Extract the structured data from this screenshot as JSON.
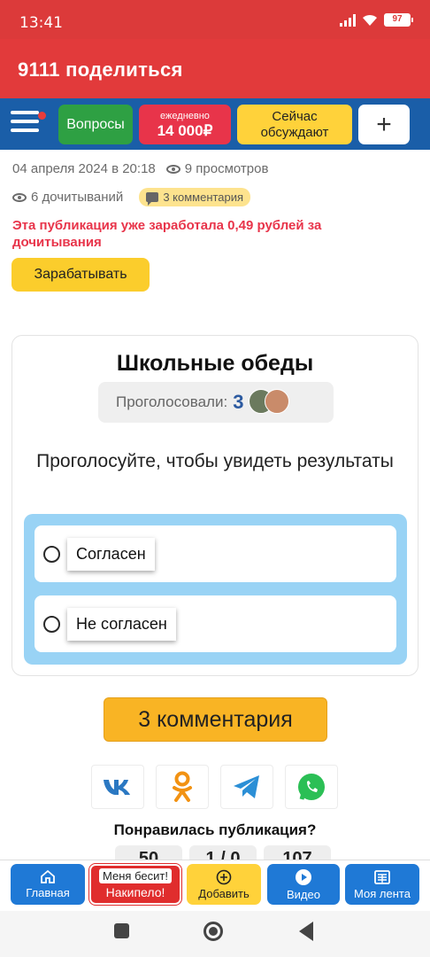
{
  "status_bar": {
    "time": "13:41",
    "battery": "97"
  },
  "app_bar": {
    "title": "9111 поделиться"
  },
  "top_nav": {
    "questions": "Вопросы",
    "daily_small": "ежедневно",
    "daily_big": "14 000₽",
    "discuss_line1": "Сейчас",
    "discuss_line2": "обсуждают",
    "plus": "+"
  },
  "post_meta": {
    "date": "04 апреля 2024 в 20:18",
    "views": "9 просмотров",
    "reads": "6 дочитываний",
    "comments_badge": "3 комментария",
    "earned_text": "Эта публикация уже заработала 0,49 рублей за дочитывания",
    "earn_button": "Зарабатывать"
  },
  "poll": {
    "title": "Школьные обеды",
    "voted_label": "Проголосовали:",
    "voted_count": "3",
    "prompt": "Проголосуйте, чтобы увидеть результаты",
    "options": [
      {
        "label": "Согласен"
      },
      {
        "label": "Не согласен"
      }
    ]
  },
  "comments_button": "3 комментария",
  "share": {
    "icons": [
      "vk-icon",
      "ok-icon",
      "telegram-icon",
      "whatsapp-icon"
    ]
  },
  "liked_question": "Понравилась публикация?",
  "reactions": [
    "50",
    "1 / 0",
    "107"
  ],
  "bottom_nav": {
    "home": "Главная",
    "angry_top": "Меня бесит!",
    "angry_bottom": "Накипело!",
    "add": "Добавить",
    "video": "Видео",
    "feed": "Моя лента"
  },
  "colors": {
    "brand_red": "#e23a3b",
    "nav_blue": "#1a5ea8",
    "accent_yellow": "#ffd23a",
    "option_frame": "#99d3f5"
  }
}
